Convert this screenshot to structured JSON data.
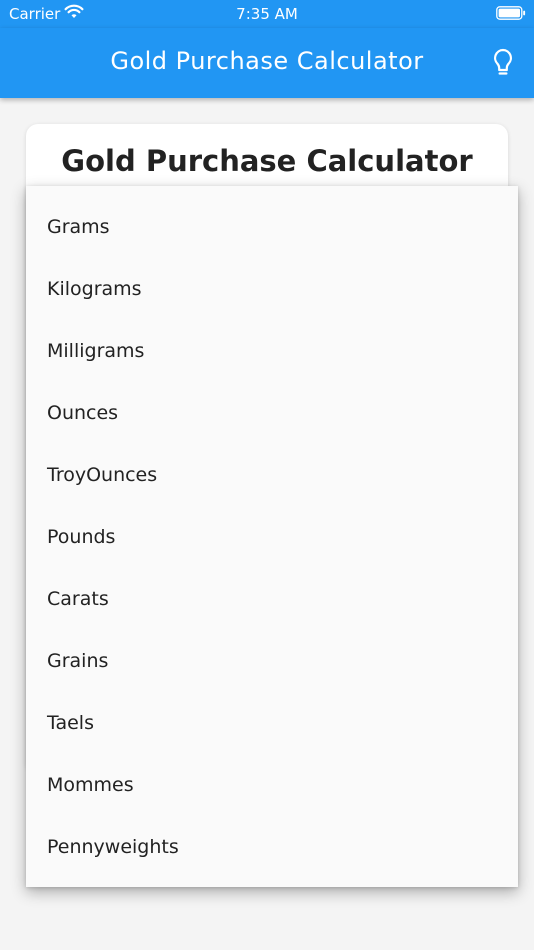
{
  "status_bar": {
    "carrier": "Carrier",
    "time": "7:35 AM"
  },
  "app_bar": {
    "title": "Gold Purchase Calculator",
    "action_icon": "lightbulb-icon",
    "color": "#2196f3"
  },
  "card": {
    "title": "Gold Purchase Calculator"
  },
  "dropdown": {
    "options": [
      "Grams",
      "Kilograms",
      "Milligrams",
      "Ounces",
      "TroyOunces",
      "Pounds",
      "Carats",
      "Grains",
      "Taels",
      "Mommes",
      "Pennyweights"
    ]
  }
}
